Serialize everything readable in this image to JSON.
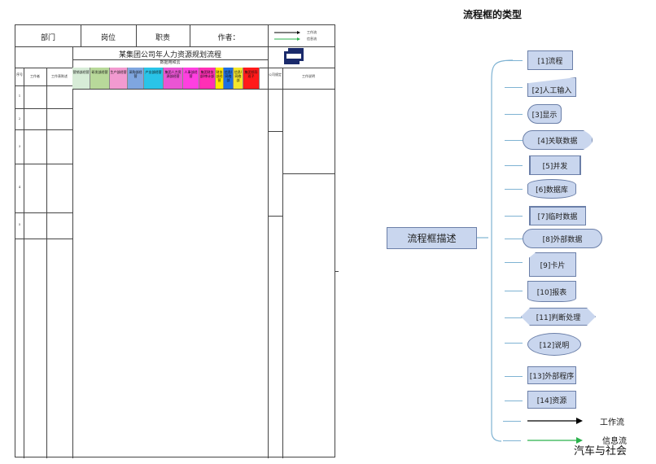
{
  "form": {
    "header": {
      "dept": "部门",
      "post": "岗位",
      "duty": "职责",
      "author": "作者：",
      "legend_work": "工作流",
      "legend_info": "信息流"
    },
    "title": "某集团公司年人力资源规划流程",
    "subheader": "数据用和云",
    "col_seq": "序号",
    "col_worker": "工作者",
    "col_source": "工作表陈述",
    "categories": [
      {
        "label": "营销部经营",
        "color": "#d7ecd7"
      },
      {
        "label": "研发部经营",
        "color": "#b8d99a"
      },
      {
        "label": "生产部经营",
        "color": "#f29ad0"
      },
      {
        "label": "采购部经营",
        "color": "#7fa6e0"
      },
      {
        "label": "产业部经营",
        "color": "#29c4e8"
      },
      {
        "label": "集团人力资源部经营",
        "color": "#ea55d4"
      },
      {
        "label": "人事部经营",
        "color": "#ff3fe0"
      },
      {
        "label": "集团财务部/审计部",
        "color": "#ff2fb5"
      },
      {
        "label": "财务部经营",
        "color": "#ffe600"
      },
      {
        "label": "信息/网络部",
        "color": "#1f6fe0"
      },
      {
        "label": "信息/网络部",
        "color": "#f3e62d"
      },
      {
        "label": "集团领导班子",
        "color": "#ff1a1a"
      }
    ],
    "col_company": "公司规定",
    "col_remark": "工作说明",
    "rows": [
      "1",
      "2",
      "3",
      "4",
      "5"
    ]
  },
  "diagram": {
    "title": "流程框的类型",
    "center": "流程框描述",
    "nodes": [
      {
        "label": "[1]流程",
        "shape": "process"
      },
      {
        "label": "[2]人工输入",
        "shape": "manual-input"
      },
      {
        "label": "[3]显示",
        "shape": "display"
      },
      {
        "label": "[4]关联数据",
        "shape": "stored-data"
      },
      {
        "label": "[5]并发",
        "shape": "parallel"
      },
      {
        "label": "[6]数据库",
        "shape": "database"
      },
      {
        "label": "[7]临时数据",
        "shape": "internal-storage"
      },
      {
        "label": "[8]外部数据",
        "shape": "external-data"
      },
      {
        "label": "[9]卡片",
        "shape": "card"
      },
      {
        "label": "[10]报表",
        "shape": "document"
      },
      {
        "label": "[11]判断处理",
        "shape": "decision"
      },
      {
        "label": "[12]说明",
        "shape": "ellipse"
      },
      {
        "label": "[13]外部程序",
        "shape": "predefined"
      },
      {
        "label": "[14]资源",
        "shape": "resource"
      }
    ],
    "work_flow": "工作流",
    "info_flow": "信息流",
    "colors": {
      "node_fill": "#c9d6ee",
      "node_stroke": "#6b7fa8",
      "bracket": "#7fb3d3",
      "work_arrow": "#000000",
      "info_arrow": "#2bb24c"
    }
  },
  "watermark": "汽车与社会"
}
